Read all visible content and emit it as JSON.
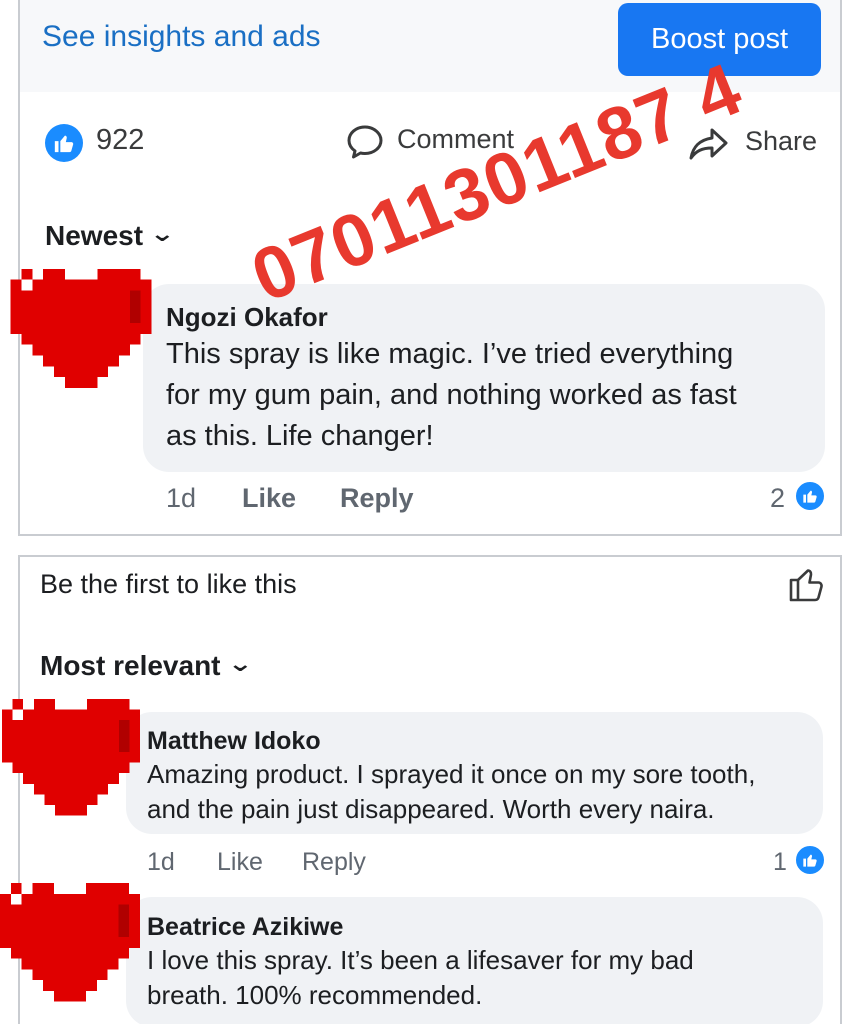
{
  "post": {
    "insights_link": "See insights and ads",
    "boost_button": "Boost post",
    "like_count": "922",
    "comment_label": "Comment",
    "share_label": "Share",
    "sort_label": "Newest",
    "watermark_phone": "07011301187 4"
  },
  "comment1": {
    "name": "Ngozi Okafor",
    "lines": [
      "This spray is like magic. I’ve tried everything",
      "for my gum pain, and nothing worked as fast",
      "as this. Life changer!"
    ],
    "time": "1d",
    "like": "Like",
    "reply": "Reply",
    "reactions": "2"
  },
  "post2": {
    "first_like_text": "Be the first to like this",
    "sort_label": "Most relevant"
  },
  "comment2": {
    "name": "Matthew Idoko",
    "lines": [
      "Amazing product. I sprayed it once on my sore tooth,",
      "and the pain just disappeared. Worth every naira."
    ],
    "time": "1d",
    "like": "Like",
    "reply": "Reply",
    "reactions": "1"
  },
  "comment3": {
    "name": "Beatrice Azikiwe",
    "lines": [
      "I love this spray. It’s been a lifesaver for my bad",
      "breath. 100% recommended."
    ]
  },
  "colors": {
    "accent": "#1877f2",
    "link": "#1a6fc4",
    "watermark": "#e8392e",
    "heart": "#e00000"
  }
}
